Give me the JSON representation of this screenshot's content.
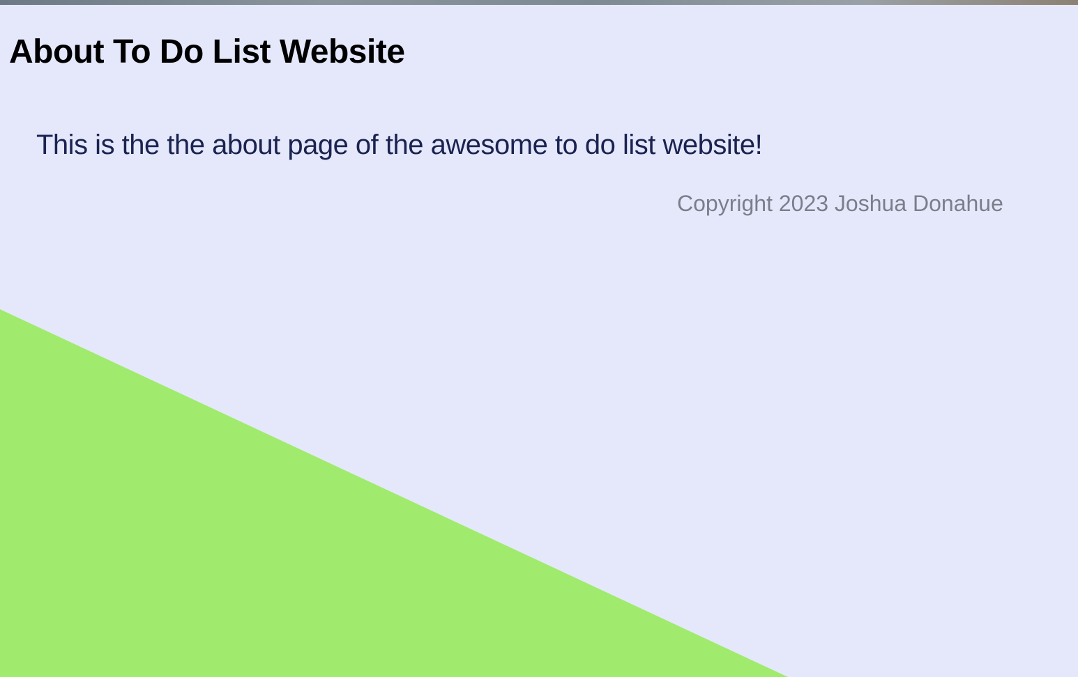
{
  "page": {
    "title": "About To Do List Website",
    "intro": "This is the the about page of the awesome to do list website!",
    "footer": {
      "copyright": "Copyright 2023 Joshua Donahue"
    }
  },
  "colors": {
    "background": "#e5e8fb",
    "decor_green": "#a0eb6e",
    "title": "#000000",
    "intro": "#1a2350",
    "copyright": "#7b7e8a"
  }
}
